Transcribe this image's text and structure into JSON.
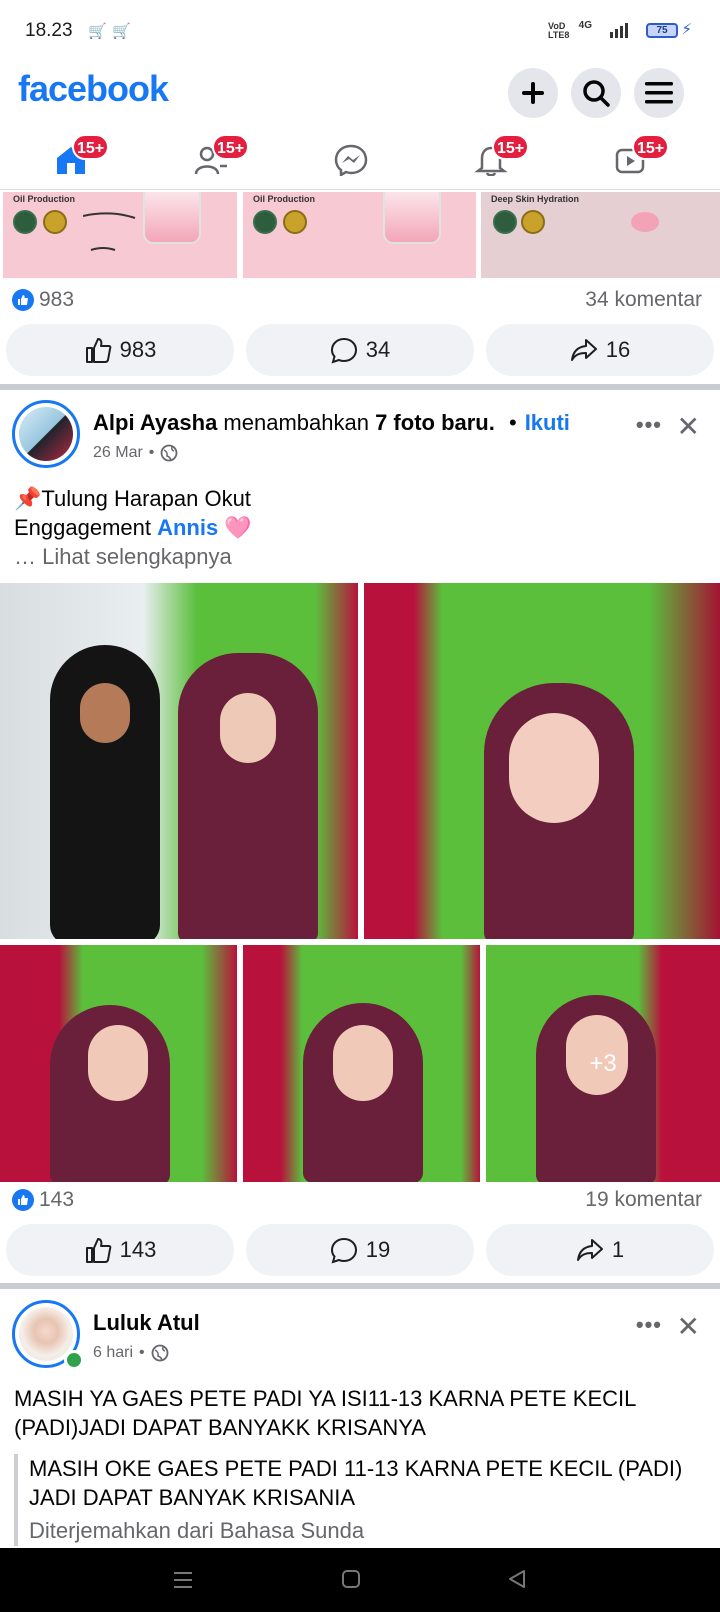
{
  "status": {
    "time": "18.23",
    "net_label": "VoD LTE8",
    "g4": "4G",
    "battery": "75"
  },
  "header": {
    "logo": "facebook"
  },
  "tabs": {
    "home_badge": "15+",
    "friends_badge": "15+",
    "notifications_badge": "15+",
    "video_badge": "15+"
  },
  "ad": {
    "captions": [
      "Oil Production",
      "Oil Production",
      "Deep Skin Hydration"
    ],
    "likes": "983",
    "comments": "34 komentar",
    "like_count": "983",
    "comment_count": "34",
    "share_count": "16"
  },
  "post1": {
    "author": "Alpi Ayasha",
    "action": " menambahkan ",
    "photos_added": "7 foto baru.",
    "bullet": "•",
    "follow": "Ikuti",
    "date": "26 Mar",
    "line1": "📌Tulung Harapan Okut",
    "line2_prefix": "Enggagement ",
    "mention": "Annis",
    "emoji": "🩷",
    "see_more": "… Lihat selengkapnya",
    "more_photos": "+3",
    "likes": "143",
    "comments": "19 komentar",
    "like_count": "143",
    "comment_count": "19",
    "share_count": "1"
  },
  "post2": {
    "author": "Luluk Atul",
    "date": "6 hari",
    "text": "MASIH YA GAES PETE PADI YA ISI11-13 KARNA PETE KECIL (PADI)JADI DAPAT BANYAKK KRISANYA",
    "translated": "MASIH OKE GAES PETE PADI 11-13 KARNA PETE KECIL (PADI) JADI DAPAT BANYAK KRISANIA",
    "translated_note": "Diterjemahkan dari Bahasa Sunda"
  },
  "icons": {
    "more": "•••",
    "close": "✕",
    "dot": "•"
  },
  "colors": {
    "brand": "#1877f2",
    "badge": "#e41e3f",
    "online": "#31a24c"
  }
}
